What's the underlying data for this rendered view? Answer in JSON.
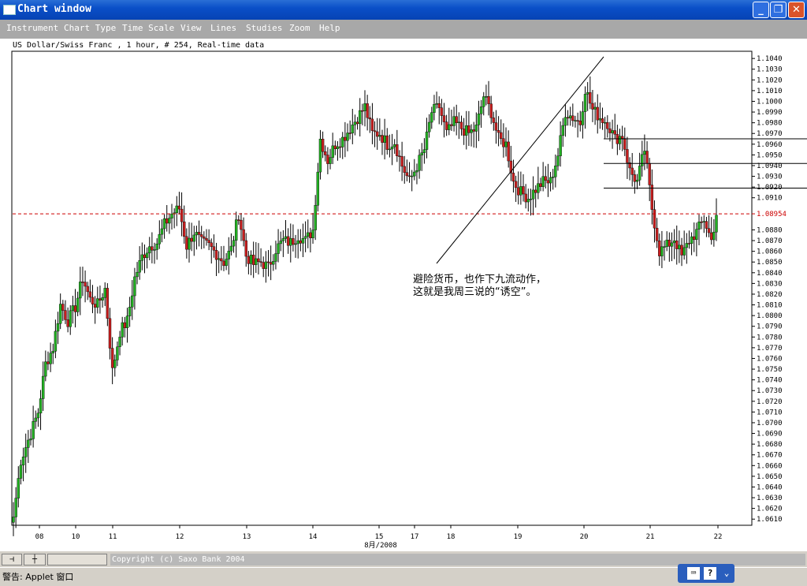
{
  "window": {
    "title": "Chart window",
    "minimize": "_",
    "restore": "❐",
    "close": "✕"
  },
  "menu": [
    {
      "label": "Instrument"
    },
    {
      "label": "Chart Type"
    },
    {
      "label": "Time Scale"
    },
    {
      "label": "View"
    },
    {
      "label": "Lines"
    },
    {
      "label": "Studies"
    },
    {
      "label": "Zoom"
    },
    {
      "label": "Help"
    }
  ],
  "chart_header": "US Dollar/Swiss Franc , 1 hour, # 254, Real-time data",
  "annotation": {
    "line1": "避险货币，也作下九流动作，",
    "line2": "这就是我周三说的“诱空”。"
  },
  "status": {
    "copyright": "Copyright (c) Saxo Bank 2004",
    "warning": "警告: Applet 窗口",
    "pin_icon": "pin-icon",
    "crosshair_icon": "crosshair-icon",
    "keyboard_icon": "keyboard-icon",
    "help_icon": "help-icon",
    "help_glyph": "?",
    "tray_arrow": "⌄"
  },
  "colors": {
    "bull": "#22b022",
    "bear": "#c81e1e",
    "current_price_line": "#cc0000"
  },
  "chart_data": {
    "type": "candlestick",
    "instrument": "US Dollar/Swiss Franc",
    "timeframe": "1 hour",
    "ylim": [
      1.0605,
      1.1046
    ],
    "y_ticks": [
      "1.1040",
      "1.1030",
      "1.1020",
      "1.1010",
      "1.1000",
      "1.0990",
      "1.0980",
      "1.0970",
      "1.0960",
      "1.0950",
      "1.0940",
      "1.0930",
      "1.0920",
      "1.0910",
      "1.0880",
      "1.0870",
      "1.0860",
      "1.0850",
      "1.0840",
      "1.0830",
      "1.0820",
      "1.0810",
      "1.0800",
      "1.0790",
      "1.0780",
      "1.0770",
      "1.0760",
      "1.0750",
      "1.0740",
      "1.0730",
      "1.0720",
      "1.0710",
      "1.0700",
      "1.0690",
      "1.0680",
      "1.0670",
      "1.0660",
      "1.0650",
      "1.0640",
      "1.0630",
      "1.0620",
      "1.0610"
    ],
    "current_price": 1.0895,
    "current_price_label": "1.08954",
    "x_ticks": [
      "08",
      "10",
      "11",
      "12",
      "13",
      "14",
      "15",
      "17",
      "18",
      "19",
      "20",
      "21",
      "22"
    ],
    "x_month_label": "8月/2008",
    "horizontal_levels": [
      1.0965,
      1.0942,
      1.0919
    ],
    "anchors": [
      [
        0,
        1.0612
      ],
      [
        3,
        1.0665
      ],
      [
        7,
        1.069
      ],
      [
        10,
        1.071
      ],
      [
        13,
        1.0755
      ],
      [
        16,
        1.077
      ],
      [
        19,
        1.081
      ],
      [
        22,
        1.0795
      ],
      [
        25,
        1.0808
      ],
      [
        28,
        1.0835
      ],
      [
        31,
        1.0815
      ],
      [
        34,
        1.081
      ],
      [
        37,
        1.0825
      ],
      [
        40,
        1.0748
      ],
      [
        43,
        1.0785
      ],
      [
        46,
        1.0795
      ],
      [
        49,
        1.0835
      ],
      [
        52,
        1.0855
      ],
      [
        55,
        1.0865
      ],
      [
        58,
        1.0868
      ],
      [
        61,
        1.0885
      ],
      [
        64,
        1.0895
      ],
      [
        67,
        1.09
      ],
      [
        70,
        1.0865
      ],
      [
        73,
        1.0878
      ],
      [
        76,
        1.0868
      ],
      [
        79,
        1.0865
      ],
      [
        82,
        1.0858
      ],
      [
        85,
        1.085
      ],
      [
        88,
        1.0862
      ],
      [
        91,
        1.0895
      ],
      [
        94,
        1.0856
      ],
      [
        97,
        1.0848
      ],
      [
        100,
        1.085
      ],
      [
        103,
        1.0845
      ],
      [
        106,
        1.0862
      ],
      [
        109,
        1.087
      ],
      [
        112,
        1.0868
      ],
      [
        115,
        1.0875
      ],
      [
        118,
        1.087
      ],
      [
        121,
        1.088
      ],
      [
        124,
        1.0965
      ],
      [
        127,
        1.0945
      ],
      [
        130,
        1.096
      ],
      [
        133,
        1.0965
      ],
      [
        136,
        1.0975
      ],
      [
        139,
        1.0985
      ],
      [
        142,
        1.0995
      ],
      [
        145,
        1.097
      ],
      [
        148,
        1.097
      ],
      [
        151,
        1.096
      ],
      [
        154,
        1.0962
      ],
      [
        157,
        1.094
      ],
      [
        160,
        1.0925
      ],
      [
        163,
        1.094
      ],
      [
        166,
        1.0955
      ],
      [
        169,
        1.099
      ],
      [
        172,
        1.0995
      ],
      [
        175,
        1.097
      ],
      [
        178,
        1.098
      ],
      [
        181,
        1.0975
      ],
      [
        184,
        1.097
      ],
      [
        187,
        1.0975
      ],
      [
        190,
        1.1005
      ],
      [
        193,
        1.099
      ],
      [
        196,
        1.0965
      ],
      [
        199,
        1.096
      ],
      [
        202,
        1.0925
      ],
      [
        205,
        1.0915
      ],
      [
        208,
        1.091
      ],
      [
        211,
        1.0918
      ],
      [
        214,
        1.0925
      ],
      [
        217,
        1.0925
      ],
      [
        220,
        1.095
      ],
      [
        223,
        1.099
      ],
      [
        226,
        1.0985
      ],
      [
        229,
        1.098
      ],
      [
        231,
        1.1012
      ],
      [
        234,
        1.0992
      ],
      [
        237,
        1.0985
      ],
      [
        240,
        1.098
      ],
      [
        243,
        1.0965
      ],
      [
        246,
        1.0968
      ],
      [
        249,
        1.0935
      ],
      [
        252,
        1.0925
      ],
      [
        255,
        1.0955
      ],
      [
        258,
        1.09
      ],
      [
        261,
        1.086
      ],
      [
        264,
        1.0865
      ],
      [
        267,
        1.0872
      ],
      [
        270,
        1.0855
      ],
      [
        273,
        1.087
      ],
      [
        276,
        1.0878
      ],
      [
        279,
        1.089
      ],
      [
        282,
        1.087
      ],
      [
        284,
        1.0895
      ]
    ]
  }
}
